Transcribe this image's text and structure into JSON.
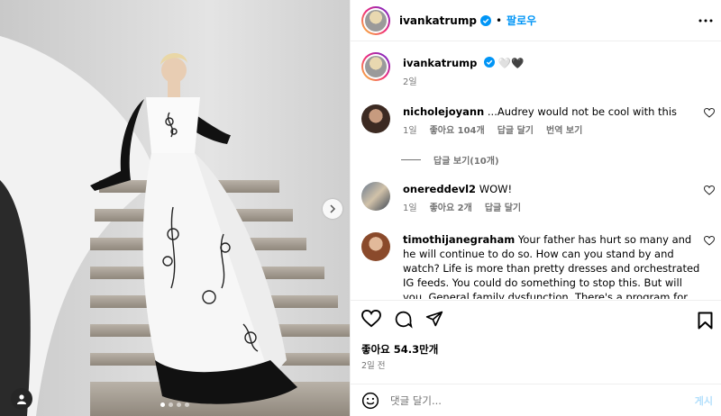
{
  "header": {
    "username": "ivankatrump",
    "separator": "•",
    "follow_label": "팔로우",
    "more_icon": "more-horizontal-icon"
  },
  "caption": {
    "username": "ivankatrump",
    "emojis": "🤍🖤",
    "time": "2일"
  },
  "comments": [
    {
      "username": "nicholejoyann",
      "text": "...Audrey would not be cool with this",
      "time": "1일",
      "likes": "좋아요 104개",
      "reply_label": "답글 달기",
      "translate_label": "번역 보기"
    },
    {
      "username": "onereddevl2",
      "text": "WOW!",
      "time": "1일",
      "likes": "좋아요 2개",
      "reply_label": "답글 달기"
    },
    {
      "username": "timothijanegraham",
      "text": "Your father has hurt so many and he will continue to do so. How can you stand by and watch? Life is more than pretty dresses and orchestrated IG feeds. You could do something to stop this. But will you. General family dysfunction. There's a program for that. ACA. You should check"
    }
  ],
  "view_replies_label": "답글 보기(10개)",
  "post_info": {
    "likes_text": "좋아요 54.3만개",
    "time_ago": "2일 전"
  },
  "add_comment": {
    "placeholder": "댓글 달기...",
    "post_label": "게시"
  },
  "carousel": {
    "count": 4,
    "active_index": 0
  },
  "colors": {
    "accent": "#0095f6",
    "muted": "#737373",
    "post_disabled": "#b2dffc"
  }
}
